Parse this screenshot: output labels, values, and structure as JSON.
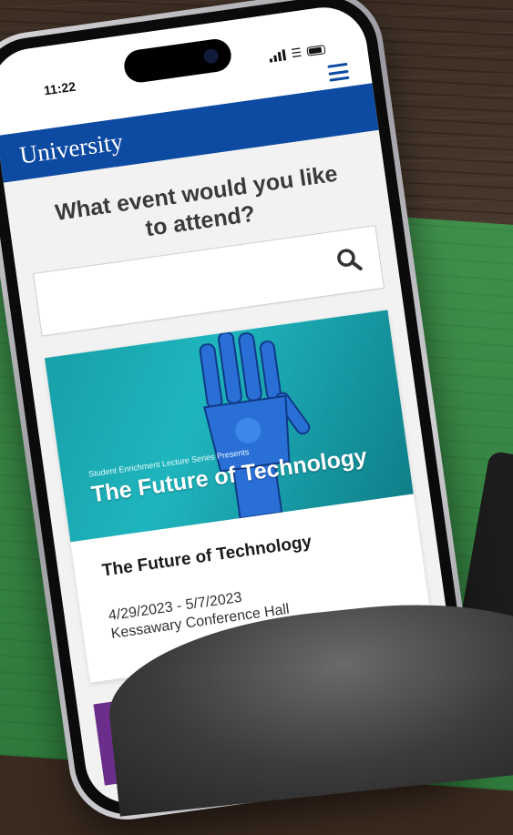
{
  "status_bar": {
    "time": "11:22"
  },
  "header": {
    "brand": "University"
  },
  "search": {
    "question": "What event would you like to attend?",
    "placeholder": "",
    "value": ""
  },
  "events": [
    {
      "image_subtitle": "Student Enrichment Lecture Series Presents",
      "image_title": "The Future of Technology",
      "title": "The Future of Technology",
      "dates": "4/29/2023 - 5/7/2023",
      "venue": "Kessawary Conference Hall"
    }
  ],
  "colors": {
    "brand_blue": "#0d4aa2",
    "image_teal": "#1fb5be"
  },
  "icons": [
    "hamburger-menu-icon",
    "search-icon",
    "signal-icon",
    "wifi-icon",
    "battery-icon"
  ]
}
